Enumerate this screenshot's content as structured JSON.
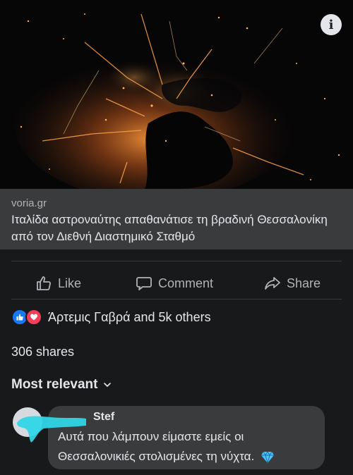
{
  "post": {
    "photo": {
      "description_icon": "info-icon",
      "info_label": "i"
    },
    "link": {
      "domain": "voria.gr",
      "title": "Ιταλίδα αστροναύτης απαθανάτισε τη βραδινή Θεσσαλονίκη από τον Διεθνή Διαστημικό Σταθμό"
    },
    "actions": [
      {
        "label": "Like",
        "icon": "thumbs-up-icon"
      },
      {
        "label": "Comment",
        "icon": "comment-icon"
      },
      {
        "label": "Share",
        "icon": "share-icon"
      }
    ],
    "reactions": {
      "icons": [
        "like-reaction-icon",
        "love-reaction-icon"
      ],
      "summary": "Άρτεμις Γαβρά and 5k others"
    },
    "shares": "306 shares",
    "comment_sort": {
      "label": "Most relevant",
      "icon": "chevron-down-icon"
    },
    "comment": {
      "author": "Stef",
      "text": "Αυτά που λάμπουν είμαστε εμείς οι Θεσσαλονικιές στολισμένες τη νύχτα.",
      "emoji": "gem-icon"
    }
  },
  "colors": {
    "background": "#18191b",
    "card": "#3a3b3d",
    "text": "#e4e6eb",
    "muted": "#b0b3b8",
    "like_blue": "#1877f2",
    "love_red": "#f33e58",
    "redaction_cyan": "#2fd6e6"
  }
}
